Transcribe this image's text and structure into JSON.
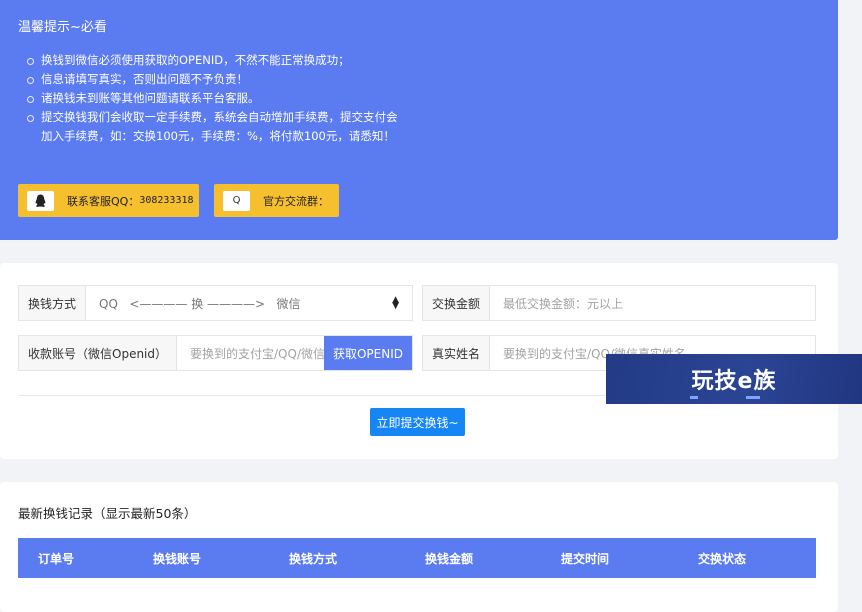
{
  "notice": {
    "title": "温馨提示~必看",
    "items": [
      "换钱到微信必须使用获取的OPENID，不然不能正常换成功；",
      "信息请填写真实，否则出问题不予负责！",
      "诸换钱未到账等其他问题请联系平台客服。",
      "提交换钱我们会收取一定手续费，系统会自动增加手续费，提交支付会加入手续费，如：交换100元，手续费：%，将付款100元，请悉知！"
    ],
    "contact_label": "联系客服QQ：",
    "contact_qq": "308233318",
    "group_label": "官方交流群："
  },
  "form": {
    "method_label": "换钱方式",
    "method_value": "QQ   <———— 换 ————>   微信",
    "amount_label": "交换金额",
    "amount_placeholder": "最低交换金额：元以上",
    "account_label": "收款账号（微信Openid）",
    "account_placeholder": "要换到的支付宝/QQ/微信账号",
    "get_openid_label": "获取OPENID",
    "name_label": "真实姓名",
    "name_placeholder": "要换到的支付宝/QQ/微信真实姓名",
    "submit_label": "立即提交换钱~"
  },
  "records": {
    "title": "最新换钱记录（显示最新50条）",
    "columns": [
      "订单号",
      "换钱账号",
      "换钱方式",
      "换钱金额",
      "提交时间",
      "交换状态"
    ]
  },
  "watermark": {
    "text": "玩技e族"
  },
  "colors": {
    "primary": "#5b7bf0",
    "accent": "#f6bf2d",
    "submit": "#1686f5",
    "watermark": "#2b4595"
  },
  "icons": {
    "contact": "qq-penguin-icon",
    "group": "qq-group-icon",
    "select": "select-arrows-icon"
  }
}
